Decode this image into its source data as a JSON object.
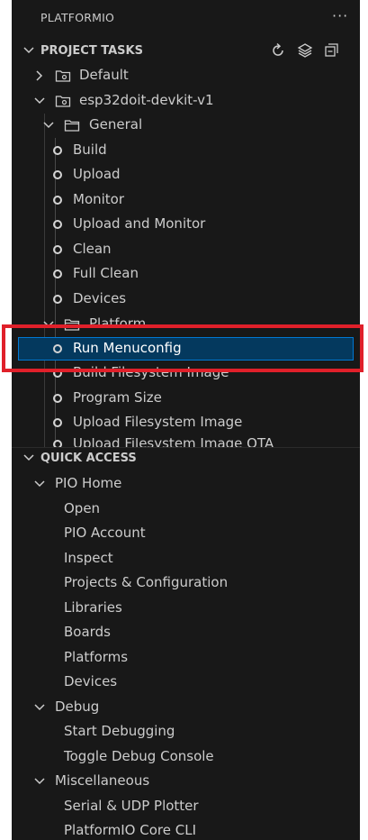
{
  "panel": {
    "title": "PLATFORMIO",
    "more_label": "···"
  },
  "project_tasks": {
    "title": "PROJECT TASKS",
    "envs": [
      {
        "label": "Default",
        "expanded": false
      },
      {
        "label": "esp32doit-devkit-v1",
        "expanded": true
      }
    ],
    "general": {
      "label": "General",
      "tasks": [
        "Build",
        "Upload",
        "Monitor",
        "Upload and Monitor",
        "Clean",
        "Full Clean",
        "Devices"
      ]
    },
    "platform": {
      "label": "Platform",
      "tasks": [
        "Run Menuconfig",
        "Build Filesystem Image",
        "Program Size",
        "Upload Filesystem Image",
        "Upload Filesystem Image OTA"
      ]
    },
    "selected_task": "Run Menuconfig"
  },
  "quick_access": {
    "title": "QUICK ACCESS",
    "groups": [
      {
        "label": "PIO Home",
        "items": [
          "Open",
          "PIO Account",
          "Inspect",
          "Projects & Configuration",
          "Libraries",
          "Boards",
          "Platforms",
          "Devices"
        ]
      },
      {
        "label": "Debug",
        "items": [
          "Start Debugging",
          "Toggle Debug Console"
        ]
      },
      {
        "label": "Miscellaneous",
        "items": [
          "Serial & UDP Plotter",
          "PlatformIO Core CLI"
        ]
      }
    ]
  },
  "colors": {
    "highlight": "#e0202a",
    "selection_bg": "#04395e",
    "selection_border": "#0078d4"
  }
}
